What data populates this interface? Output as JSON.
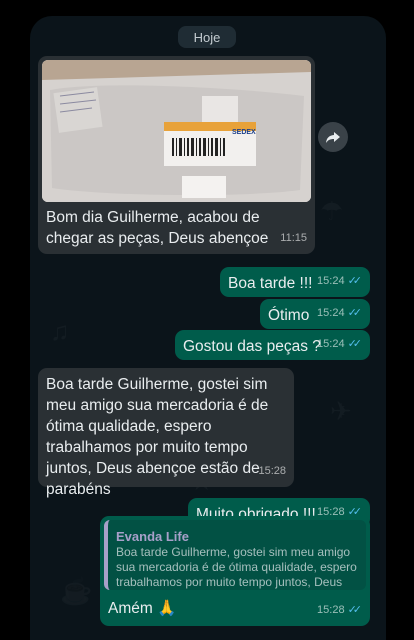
{
  "date_chip": "Hoje",
  "messages": [
    {
      "direction": "in",
      "type": "image",
      "caption": "Bom dia Guilherme, acabou de chegar as peças, Deus abençoe",
      "time": "11:15"
    },
    {
      "direction": "out",
      "text": "Boa tarde !!!",
      "time": "15:24",
      "status": "read"
    },
    {
      "direction": "out",
      "text": "Ótimo",
      "time": "15:24",
      "status": "read"
    },
    {
      "direction": "out",
      "text": "Gostou das peças ?",
      "time": "15:24",
      "status": "read"
    },
    {
      "direction": "in",
      "text": "Boa tarde Guilherme, gostei sim meu amigo sua mercadoria é de ótima qualidade, espero trabalhamos por muito tempo juntos, Deus abençoe estão de parabéns",
      "time": "15:28"
    },
    {
      "direction": "out",
      "text": "Muito obrigado !!!",
      "time": "15:28",
      "status": "read"
    },
    {
      "direction": "out",
      "type": "reply",
      "quote_author": "Evanda Life",
      "quote_text": "Boa tarde Guilherme, gostei sim meu amigo sua mercadoria é de ótima qualidade, espero trabalhamos por muito tempo juntos, Deus abe…",
      "text": "Amém 🙏",
      "time": "15:28",
      "status": "read"
    }
  ],
  "photo_labels": {
    "badge": "SEDEX"
  },
  "icons": {
    "forward": "forward-icon",
    "read_receipt": "double-check-icon",
    "prayer": "folded-hands-emoji"
  },
  "colors": {
    "incoming": "#2a3034",
    "outgoing": "#005c4b",
    "background": "#0b141a",
    "ticks": "#53bdeb",
    "quote_author": "#a7a0c9"
  }
}
